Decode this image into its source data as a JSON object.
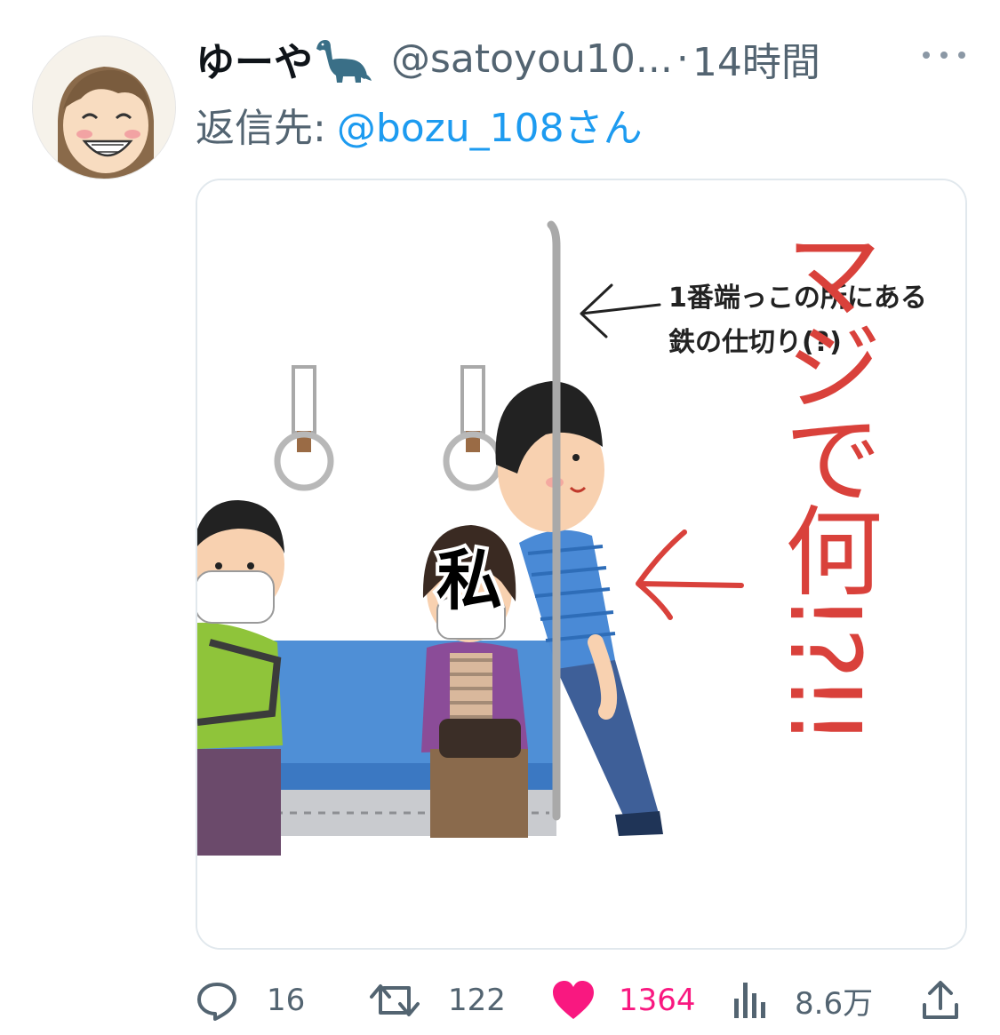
{
  "tweet": {
    "author_name": "ゆーや",
    "author_emoji_icon": "sauropod-dinosaur-icon",
    "handle": "@satoyou10...",
    "separator": "·",
    "time": "14時間",
    "reply_prefix": "返信先:",
    "reply_target": "@bozu_108さん"
  },
  "media": {
    "caption_line1": "1番端っこの所にある",
    "caption_line2": "鉄の仕切り(?)",
    "face_label": "私",
    "handwritten_note": "マジで何!?!!"
  },
  "actions": {
    "reply_count": "16",
    "retweet_count": "122",
    "like_count": "1364",
    "views_count": "8.6万"
  },
  "colors": {
    "like_accent": "#f91880",
    "link_blue": "#1d9bf0",
    "secondary_text": "#536471",
    "annotation_red": "#d9413b"
  }
}
